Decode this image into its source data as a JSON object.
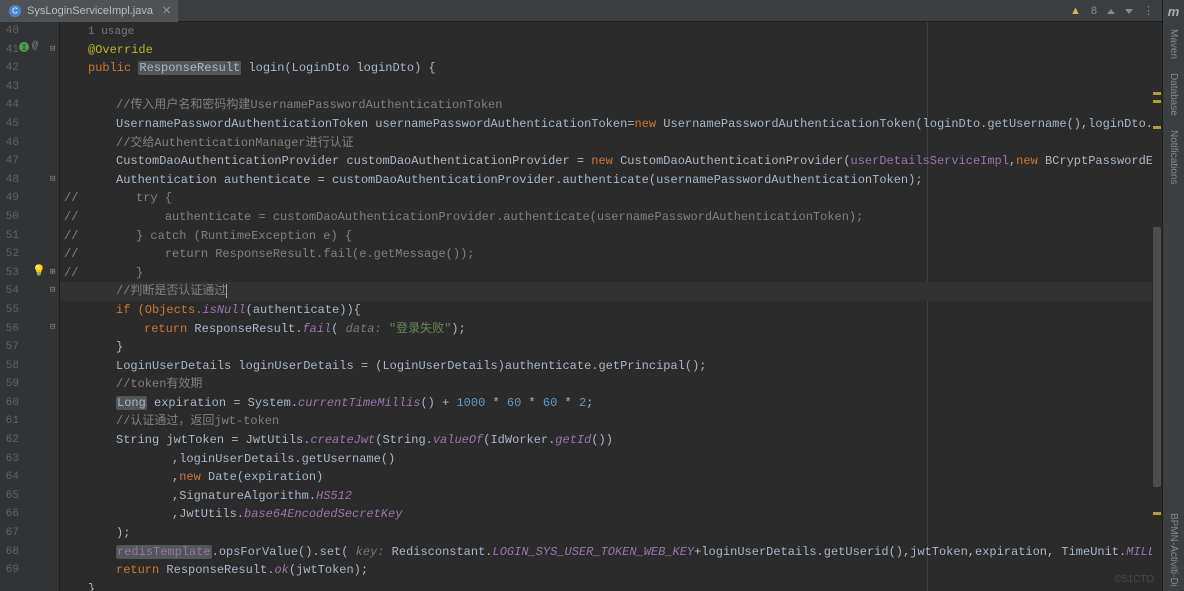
{
  "tab": {
    "filename": "SysLoginServiceImpl.java",
    "icon": "java-class"
  },
  "topbar": {
    "warnings": "8"
  },
  "gutter": {
    "start": 40,
    "end": 69,
    "impl_at": 41,
    "bulb_at": 53,
    "folds": [
      41,
      48,
      53,
      54,
      56
    ]
  },
  "rightbar": {
    "maven": "Maven",
    "database": "Database",
    "notifications": "Notifications",
    "bpmn": "BPMN-Activiti-Di"
  },
  "watermark": "©51CTO",
  "code": {
    "l40_hint": "1 usage",
    "l41": "@Override",
    "l42_pre": "public ",
    "l42_type": "ResponseResult",
    "l42_mid": " login(LoginDto loginDto) {",
    "l44_com": "//传入用户名和密码构建UsernamePasswordAuthenticationToken",
    "l45_a": "UsernamePasswordAuthenticationToken usernamePasswordAuthenticationToken=",
    "l45_new": "new ",
    "l45_b": "UsernamePasswordAuthenticationToken(loginDto.getUsername(),loginDto.getPassword()",
    "l46_com": "//交给AuthenticationManager进行认证",
    "l47_a": "CustomDaoAuthenticationProvider customDaoAuthenticationProvider = ",
    "l47_new": "new ",
    "l47_b": "CustomDaoAuthenticationProvider(",
    "l47_field": "userDetailsServiceImpl",
    "l47_c": ",",
    "l47_new2": "new ",
    "l47_d": "BCryptPasswordEncoder());",
    "l48": "Authentication authenticate = customDaoAuthenticationProvider.authenticate(usernamePasswordAuthenticationToken);",
    "l49": "//        try {",
    "l50": "//            authenticate = customDaoAuthenticationProvider.authenticate(usernamePasswordAuthenticationToken);",
    "l51": "//        } catch (RuntimeException e) {",
    "l52": "//            return ResponseResult.fail(e.getMessage());",
    "l53": "//        }",
    "l54_com": "//判断是否认证通过",
    "l55_a": "if (Objects.",
    "l55_s": "isNull",
    "l55_b": "(authenticate)){",
    "l56_a": "return ",
    "l56_b": "ResponseResult.",
    "l56_s": "fail",
    "l56_c": "( ",
    "l56_hint": "data: ",
    "l56_str": "\"登录失败\"",
    "l56_d": ");",
    "l57": "}",
    "l58": "LoginUserDetails loginUserDetails = (LoginUserDetails)authenticate.getPrincipal();",
    "l59_com": "//token有效期",
    "l60_a": "Long",
    "l60_b": " expiration = System.",
    "l60_s": "currentTimeMillis",
    "l60_c": "() + ",
    "l60_n1": "1000",
    "l60_n2": "60",
    "l60_n3": "60",
    "l60_n4": "2",
    "l61_com": "//认证通过，返回jwt-token",
    "l62_a": "String jwtToken = JwtUtils.",
    "l62_s": "createJwt",
    "l62_b": "(String.",
    "l62_s2": "valueOf",
    "l62_c": "(IdWorker.",
    "l62_s3": "getId",
    "l62_d": "())",
    "l63": ",loginUserDetails.getUsername()",
    "l64_a": ",",
    "l64_new": "new ",
    "l64_b": "Date(expiration)",
    "l65_a": ",SignatureAlgorithm.",
    "l65_f": "HS512",
    "l66_a": ",JwtUtils.",
    "l66_f": "base64EncodedSecretKey",
    "l67": ");",
    "l68_a": "redisTemplate",
    "l68_b": ".opsForValue().set( ",
    "l68_hint": "key: ",
    "l68_c": "Redisconstant.",
    "l68_f": "LOGIN_SYS_USER_TOKEN_WEB_KEY",
    "l68_d": "+loginUserDetails.getUserid(),jwtToken,expiration, TimeUnit.",
    "l68_f2": "MILLISECONDS",
    "l68_e": ");",
    "l69_a": "return ",
    "l69_b": "ResponseResult.",
    "l69_s": "ok",
    "l69_c": "(jwtToken);",
    "l70": "}"
  }
}
